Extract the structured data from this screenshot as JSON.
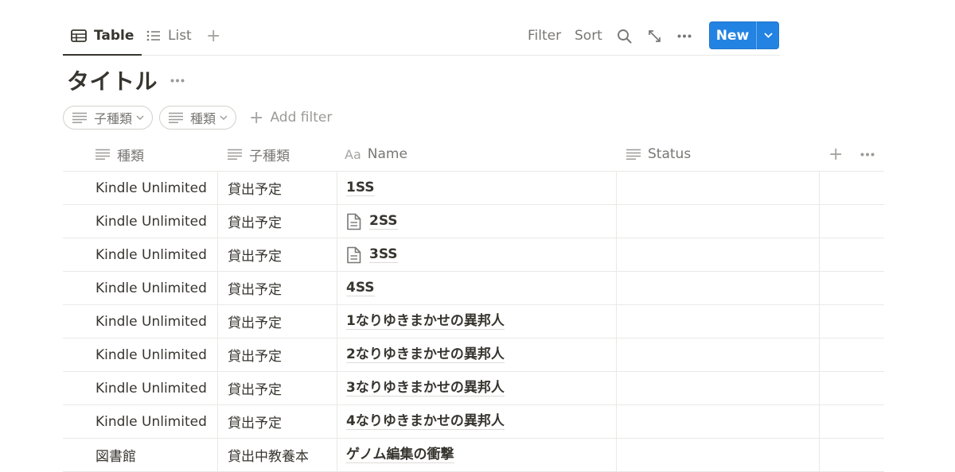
{
  "views": {
    "tabs": [
      {
        "label": "Table",
        "icon": "table-icon",
        "active": true
      },
      {
        "label": "List",
        "icon": "list-icon",
        "active": false
      }
    ],
    "add_label": "+"
  },
  "toolbar": {
    "filter_label": "Filter",
    "sort_label": "Sort",
    "new_label": "New",
    "accent_color": "#2383e2"
  },
  "page": {
    "title": "タイトル"
  },
  "filters": {
    "chips": [
      {
        "label": "子種類",
        "icon": "text-property-icon"
      },
      {
        "label": "種類",
        "icon": "text-property-icon"
      }
    ],
    "add_filter_label": "Add filter"
  },
  "table": {
    "columns": [
      {
        "label": "種類",
        "icon": "text-property-icon"
      },
      {
        "label": "子種類",
        "icon": "text-property-icon"
      },
      {
        "label": "Name",
        "icon_text": "Aa"
      },
      {
        "label": "Status",
        "icon": "text-property-icon"
      }
    ],
    "rows": [
      {
        "type": "Kindle Unlimited",
        "subtype": "貸出予定",
        "name": "1SS",
        "page_icon": false
      },
      {
        "type": "Kindle Unlimited",
        "subtype": "貸出予定",
        "name": "2SS",
        "page_icon": true
      },
      {
        "type": "Kindle Unlimited",
        "subtype": "貸出予定",
        "name": "3SS",
        "page_icon": true
      },
      {
        "type": "Kindle Unlimited",
        "subtype": "貸出予定",
        "name": "4SS",
        "page_icon": false
      },
      {
        "type": "Kindle Unlimited",
        "subtype": "貸出予定",
        "name": "1なりゆきまかせの異邦人",
        "page_icon": false
      },
      {
        "type": "Kindle Unlimited",
        "subtype": "貸出予定",
        "name": "2なりゆきまかせの異邦人",
        "page_icon": false
      },
      {
        "type": "Kindle Unlimited",
        "subtype": "貸出予定",
        "name": "3なりゆきまかせの異邦人",
        "page_icon": false
      },
      {
        "type": "Kindle Unlimited",
        "subtype": "貸出予定",
        "name": "4なりゆきまかせの異邦人",
        "page_icon": false
      },
      {
        "type": "図書館",
        "subtype": "貸出中教養本",
        "name": "ゲノム編集の衝撃",
        "page_icon": false
      }
    ]
  }
}
